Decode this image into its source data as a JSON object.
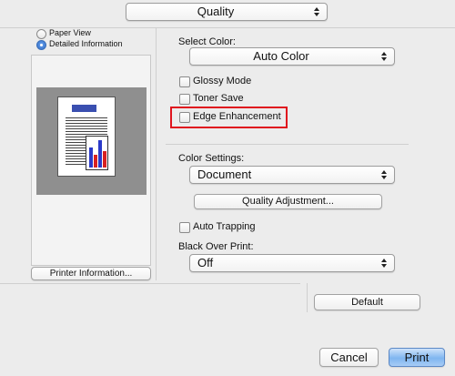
{
  "top_popup": {
    "value": "Quality"
  },
  "preview": {
    "radio_options": [
      {
        "label": "Paper View",
        "selected": false
      },
      {
        "label": "Detailed Information",
        "selected": true
      }
    ],
    "printer_info_button": "Printer Information..."
  },
  "settings": {
    "select_color_label": "Select Color:",
    "select_color_value": "Auto Color",
    "checkboxes": [
      {
        "label": "Glossy Mode",
        "checked": false
      },
      {
        "label": "Toner Save",
        "checked": false
      },
      {
        "label": "Edge Enhancement",
        "checked": false
      }
    ],
    "highlight_color": "#e0141e",
    "color_settings_label": "Color Settings:",
    "color_settings_value": "Document",
    "quality_adjustment_button": "Quality Adjustment...",
    "auto_trapping_label": "Auto Trapping",
    "auto_trapping_checked": false,
    "black_over_print_label": "Black Over Print:",
    "black_over_print_value": "Off"
  },
  "buttons": {
    "default": "Default",
    "cancel": "Cancel",
    "print": "Print"
  },
  "colors": {
    "print_button": "#7fb6f0",
    "window_bg": "#ececec"
  }
}
